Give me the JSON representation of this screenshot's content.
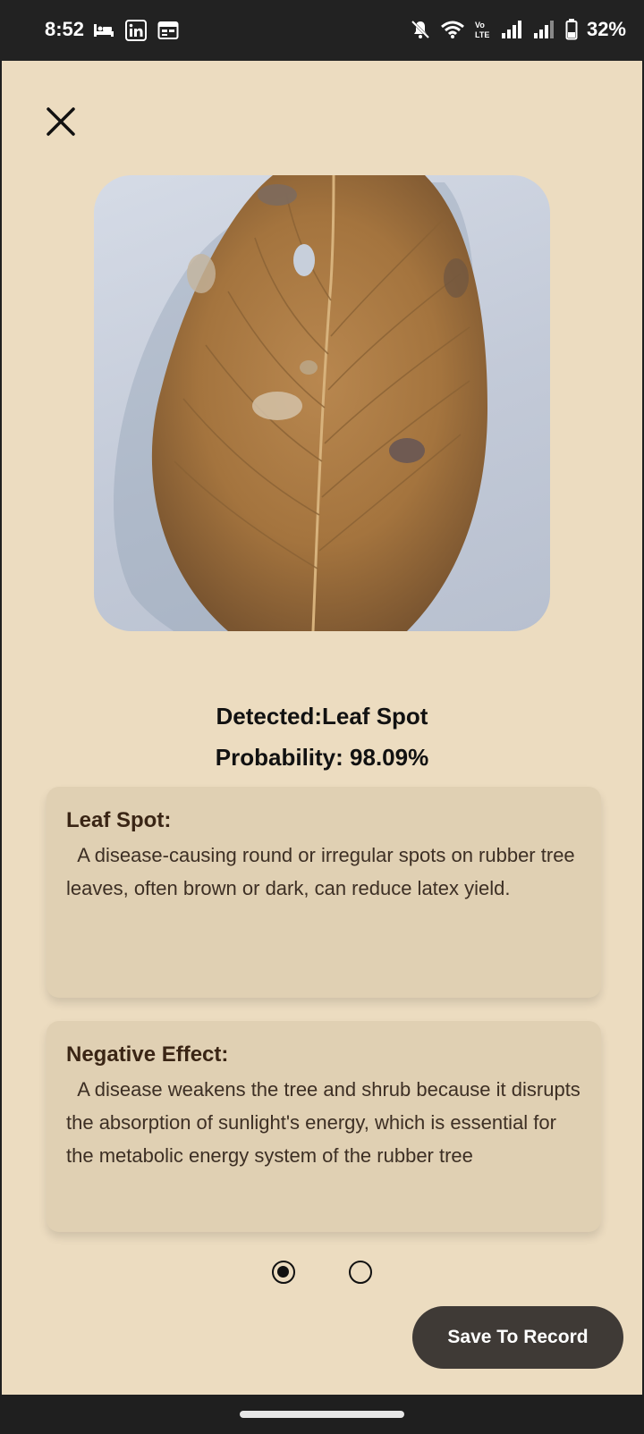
{
  "status_bar": {
    "time": "8:52",
    "battery": "32%",
    "left_icons": [
      "sleep-icon",
      "linkedin-icon",
      "calendar-icon"
    ],
    "right_icons": [
      "notifications-off-icon",
      "wifi-icon",
      "volte-icon",
      "signal-icon",
      "signal-icon",
      "battery-icon"
    ]
  },
  "header": {
    "close_icon": "close-icon"
  },
  "result": {
    "detected": "Detected:Leaf Spot",
    "probability": "Probability: 98.09%"
  },
  "cards": [
    {
      "title": "Leaf Spot:",
      "body": "  A disease-causing round or irregular spots on rubber tree leaves, often brown or dark, can reduce latex yield."
    },
    {
      "title": "Negative Effect:",
      "body": "  A disease weakens the tree and shrub because it disrupts the absorption of sunlight's energy, which is essential for the metabolic energy system of the rubber tree"
    }
  ],
  "pager": {
    "page_count": 2,
    "active_page": 1
  },
  "actions": {
    "save_label": "Save To Record"
  },
  "colors": {
    "background": "#ecdcc0",
    "card": "#e0d0b3",
    "button": "#3f3a36",
    "text": "#111111"
  }
}
